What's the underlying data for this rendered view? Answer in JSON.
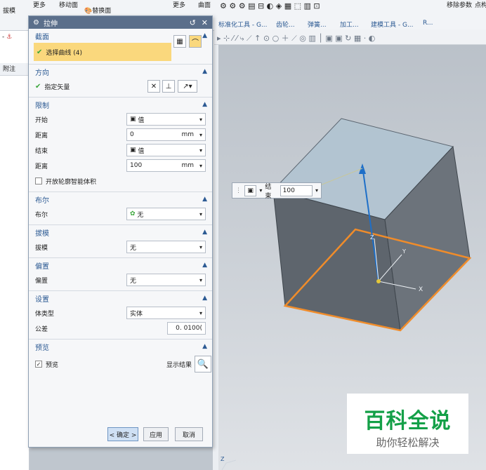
{
  "ribbon": {
    "items": [
      "拔模",
      "更多",
      "移动面",
      "替换面",
      "更多",
      "曲面",
      "移除参数",
      "点构",
      "标准化工具 - G...",
      "齿轮...",
      "弹簧...",
      "加工...",
      "建模工具 - G...",
      "R..."
    ]
  },
  "left_pane": {
    "partial_label": "- ",
    "column": "附注"
  },
  "dialog": {
    "title": "拉伸",
    "sections": {
      "section": {
        "title": "截面",
        "select_curve": "选择曲线 (4)"
      },
      "direction": {
        "title": "方向",
        "vector": "指定矢量"
      },
      "limits": {
        "title": "限制",
        "start_label": "开始",
        "start_value": "值",
        "dist1_label": "距离",
        "dist1_value": "0",
        "dist1_unit": "mm",
        "end_label": "结束",
        "end_value": "值",
        "dist2_label": "距离",
        "dist2_value": "100",
        "dist2_unit": "mm",
        "open_profile": "开放轮廓智能体积"
      },
      "boolean": {
        "title": "布尔",
        "label": "布尔",
        "value": "无"
      },
      "draft": {
        "title": "拔模",
        "label": "拔模",
        "value": "无"
      },
      "offset": {
        "title": "偏置",
        "label": "偏置",
        "value": "无"
      },
      "settings": {
        "title": "设置",
        "body_type_label": "体类型",
        "body_type_value": "实体",
        "tolerance_label": "公差",
        "tolerance_value": "0. 0100("
      },
      "preview": {
        "title": "预览",
        "preview_label": "预览",
        "show_result": "显示结果"
      }
    },
    "buttons": {
      "ok": "< 确定 >",
      "apply": "应用",
      "cancel": "取消"
    }
  },
  "float_label": {
    "end_label": "结束",
    "end_value": "100"
  },
  "axes": {
    "x": "X",
    "y": "Y",
    "z": "Z"
  },
  "watermark": {
    "line1": "百科全说",
    "line2": "助你轻松解决"
  },
  "colors": {
    "dialog_title": "#5b6f8b",
    "section_title": "#2c5a93",
    "selected_row": "#fad87d",
    "edge_highlight": "#f08c2a",
    "vector": "#1e6fc8",
    "watermark": "#14a048"
  }
}
